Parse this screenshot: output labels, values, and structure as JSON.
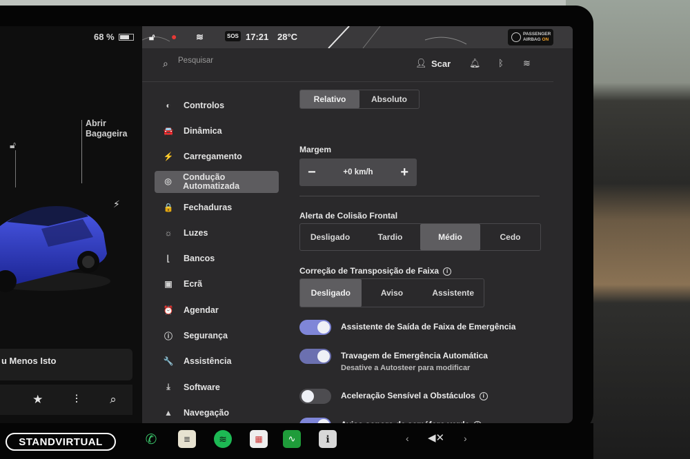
{
  "status": {
    "battery": "68 %",
    "time": "17:21",
    "temperature": "28°C",
    "sos": "SOS",
    "airbag_line1": "PASSENGER",
    "airbag_line2": "AIRBAG",
    "airbag_state": "ON"
  },
  "car": {
    "trunk_label": "Abrir Bagageira",
    "media_title": "u Menos Isto"
  },
  "search": {
    "placeholder": "Pesquisar"
  },
  "user": {
    "name": "Scar"
  },
  "sidebar": {
    "items": [
      {
        "label": "Controlos",
        "icon": "toggle-icon",
        "glyph": "◐"
      },
      {
        "label": "Dinâmica",
        "icon": "car-icon",
        "glyph": "🚘"
      },
      {
        "label": "Carregamento",
        "icon": "bolt-icon",
        "glyph": "⚡"
      },
      {
        "label": "Condução Automatizada",
        "icon": "steering-wheel-icon",
        "glyph": "◎"
      },
      {
        "label": "Fechaduras",
        "icon": "lock-icon",
        "glyph": "🔒"
      },
      {
        "label": "Luzes",
        "icon": "light-icon",
        "glyph": "☼"
      },
      {
        "label": "Bancos",
        "icon": "seat-icon",
        "glyph": "⌊"
      },
      {
        "label": "Ecrã",
        "icon": "display-icon",
        "glyph": "▣"
      },
      {
        "label": "Agendar",
        "icon": "clock-icon",
        "glyph": "⏰"
      },
      {
        "label": "Segurança",
        "icon": "alert-icon",
        "glyph": "ⓘ"
      },
      {
        "label": "Assistência",
        "icon": "wrench-icon",
        "glyph": "🔧"
      },
      {
        "label": "Software",
        "icon": "download-icon",
        "glyph": "⤓"
      },
      {
        "label": "Navegação",
        "icon": "navigation-icon",
        "glyph": "▲"
      }
    ],
    "active_index": 3
  },
  "settings": {
    "distance_mode": {
      "options": [
        "Relativo",
        "Absoluto"
      ],
      "selected": "Relativo"
    },
    "margin": {
      "label": "Margem",
      "value": "+0 km/h",
      "minus": "−",
      "plus": "+"
    },
    "collision_alert": {
      "label": "Alerta de Colisão Frontal",
      "options": [
        "Desligado",
        "Tardio",
        "Médio",
        "Cedo"
      ],
      "selected": "Médio"
    },
    "lane_departure": {
      "label": "Correção de Transposição de Faixa",
      "options": [
        "Desligado",
        "Aviso",
        "Assistente"
      ],
      "selected": "Desligado"
    },
    "toggles": [
      {
        "label": "Assistente de Saída de Faixa de Emergência",
        "state": "on",
        "sub": ""
      },
      {
        "label": "Travagem de Emergência Automática",
        "state": "on",
        "sub": "Desative a Autosteer para modificar"
      },
      {
        "label": "Aceleração Sensível a Obstáculos",
        "state": "off",
        "sub": ""
      },
      {
        "label": "Aviso sonoro de semáforo verde",
        "state": "on",
        "sub": ""
      }
    ]
  },
  "taskbar": {
    "watermark": "STANDVIRTUAL",
    "volume": "◀✕"
  },
  "colors": {
    "toggle_on": "#7f86d8",
    "panel_bg": "#2a292b",
    "selected_bg": "#5e5d60",
    "car_blue": "#2a35b8"
  }
}
